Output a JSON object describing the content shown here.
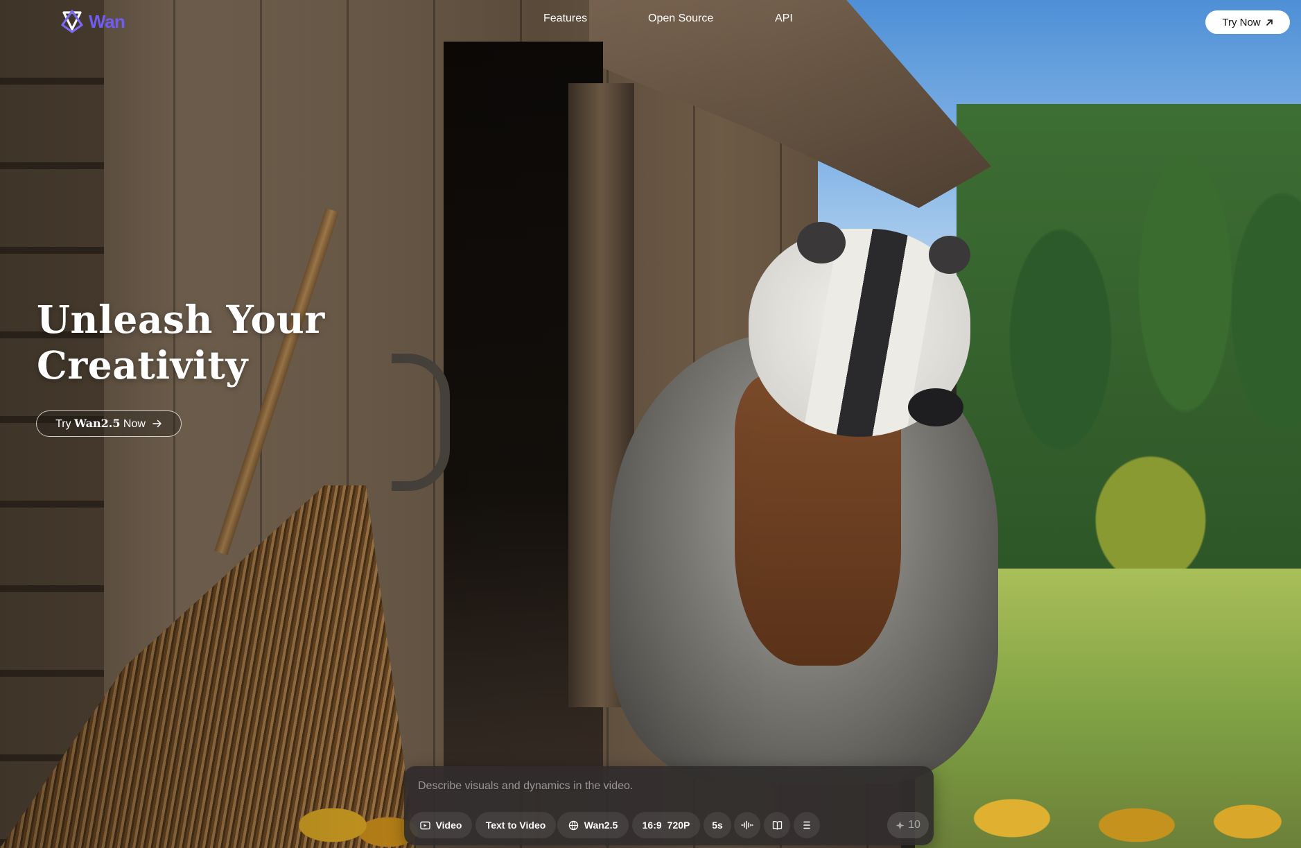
{
  "header": {
    "logo_text": "Wan",
    "nav": [
      "Features",
      "Open Source",
      "API"
    ],
    "try_now_label": "Try Now"
  },
  "hero": {
    "title_line1": "Unleash Your",
    "title_line2": "Creativity",
    "cta_prefix": "Try",
    "cta_brand": "Wan2.5",
    "cta_suffix": "Now"
  },
  "prompt": {
    "placeholder": "Describe visuals and dynamics in the video.",
    "chips": {
      "mode": "Video",
      "type": "Text to Video",
      "model": "Wan2.5",
      "ratio": "16:9",
      "resolution": "720P",
      "duration": "5s"
    },
    "credits": "10"
  },
  "icons": {
    "logo": "wan-logo-icon",
    "external": "arrow-up-right-icon",
    "cta": "arrow-right-icon",
    "video": "video-icon",
    "model": "globe-icon",
    "audio": "audio-wave-icon",
    "book": "book-icon",
    "menu": "menu-lines-icon",
    "credit": "sparkle-icon"
  },
  "colors": {
    "logo": "#6f5cf0",
    "try_now_bg": "#ffffff",
    "prompt_bg": "#302c2c"
  }
}
